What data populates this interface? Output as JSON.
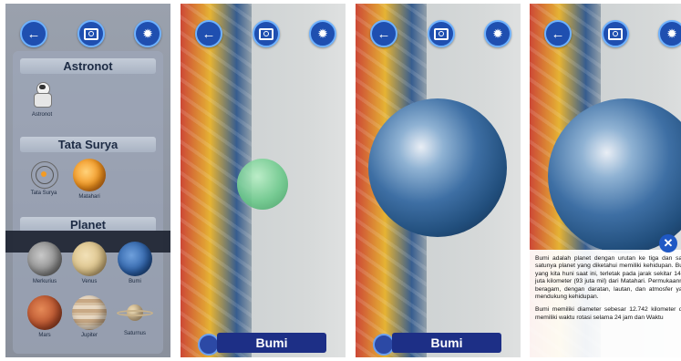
{
  "common": {
    "icons": {
      "back": "arrow-left-icon",
      "camera": "camera-icon",
      "ar": "ar-molecule-icon"
    }
  },
  "menu": {
    "sections": [
      {
        "title": "Astronot",
        "items": [
          {
            "label": "Astronot"
          }
        ]
      },
      {
        "title": "Tata Surya",
        "items": [
          {
            "label": "Tata Surya"
          },
          {
            "label": "Matahari"
          }
        ]
      },
      {
        "title": "Planet",
        "items": [
          {
            "label": "Merkurius"
          },
          {
            "label": "Venus"
          },
          {
            "label": "Bumi"
          },
          {
            "label": "Mars"
          },
          {
            "label": "Jupiter"
          },
          {
            "label": "Saturnus"
          }
        ]
      }
    ]
  },
  "viewer": {
    "planet_name": "Bumi"
  },
  "info": {
    "paragraph1": "Bumi adalah planet dengan urutan ke tiga dan satu-satunya planet yang diketahui memiliki kehidupan. Bumi yang kita huni saat ini, terletak pada jarak sekitar 149,6 juta kilometer (93 juta mil) dari Matahari. Permukaannya beragam, dengan daratan, lautan, dan atmosfer yang mendukung kehidupan.",
    "paragraph2": "Bumi memiliki diameter sebesar 12.742 kilometer dan memiliki waktu rotasi selama 24 jam dan Waktu"
  },
  "colors": {
    "button": "#1f4fb0",
    "bar": "#1d2f86",
    "accent": "#6fb2ff"
  }
}
